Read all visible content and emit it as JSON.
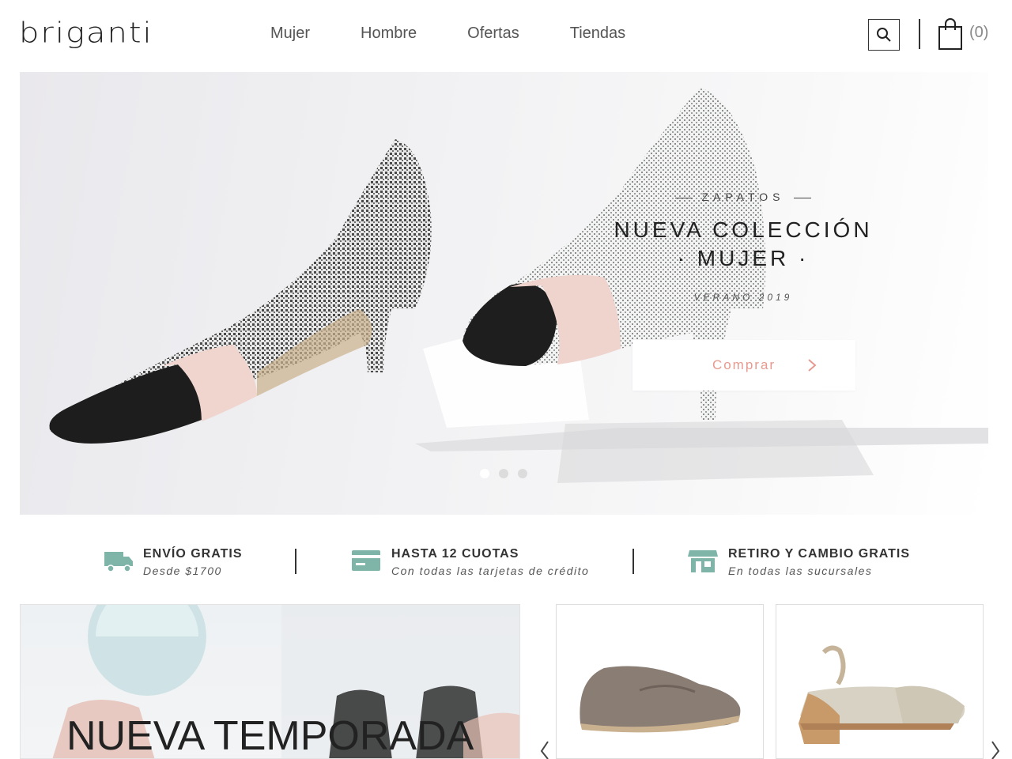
{
  "brand": {
    "logo_text": "briganti"
  },
  "nav": {
    "items": [
      {
        "label": "Mujer"
      },
      {
        "label": "Hombre"
      },
      {
        "label": "Ofertas"
      },
      {
        "label": "Tiendas"
      }
    ]
  },
  "cart": {
    "count": "(0)"
  },
  "hero": {
    "eyebrow": "ZAPATOS",
    "title_line1": "NUEVA COLECCIÓN",
    "title_line2": "· MUJER ·",
    "subtitle": "VERANO 2019",
    "button_label": "Comprar",
    "slides": 3,
    "active_slide": 1
  },
  "benefits": [
    {
      "title": "ENVÍO GRATIS",
      "subtitle": "Desde $1700",
      "icon": "truck-icon"
    },
    {
      "title": "HASTA 12 CUOTAS",
      "subtitle": "Con todas las tarjetas de crédito",
      "icon": "credit-card-icon"
    },
    {
      "title": "RETIRO Y CAMBIO GRATIS",
      "subtitle": "En todas las sucursales",
      "icon": "store-icon"
    }
  ],
  "promo": {
    "title": "NUEVA TEMPORADA"
  },
  "colors": {
    "accent": "#e79a8f",
    "benefit_icon": "#7fb5a8",
    "text": "#333333"
  }
}
